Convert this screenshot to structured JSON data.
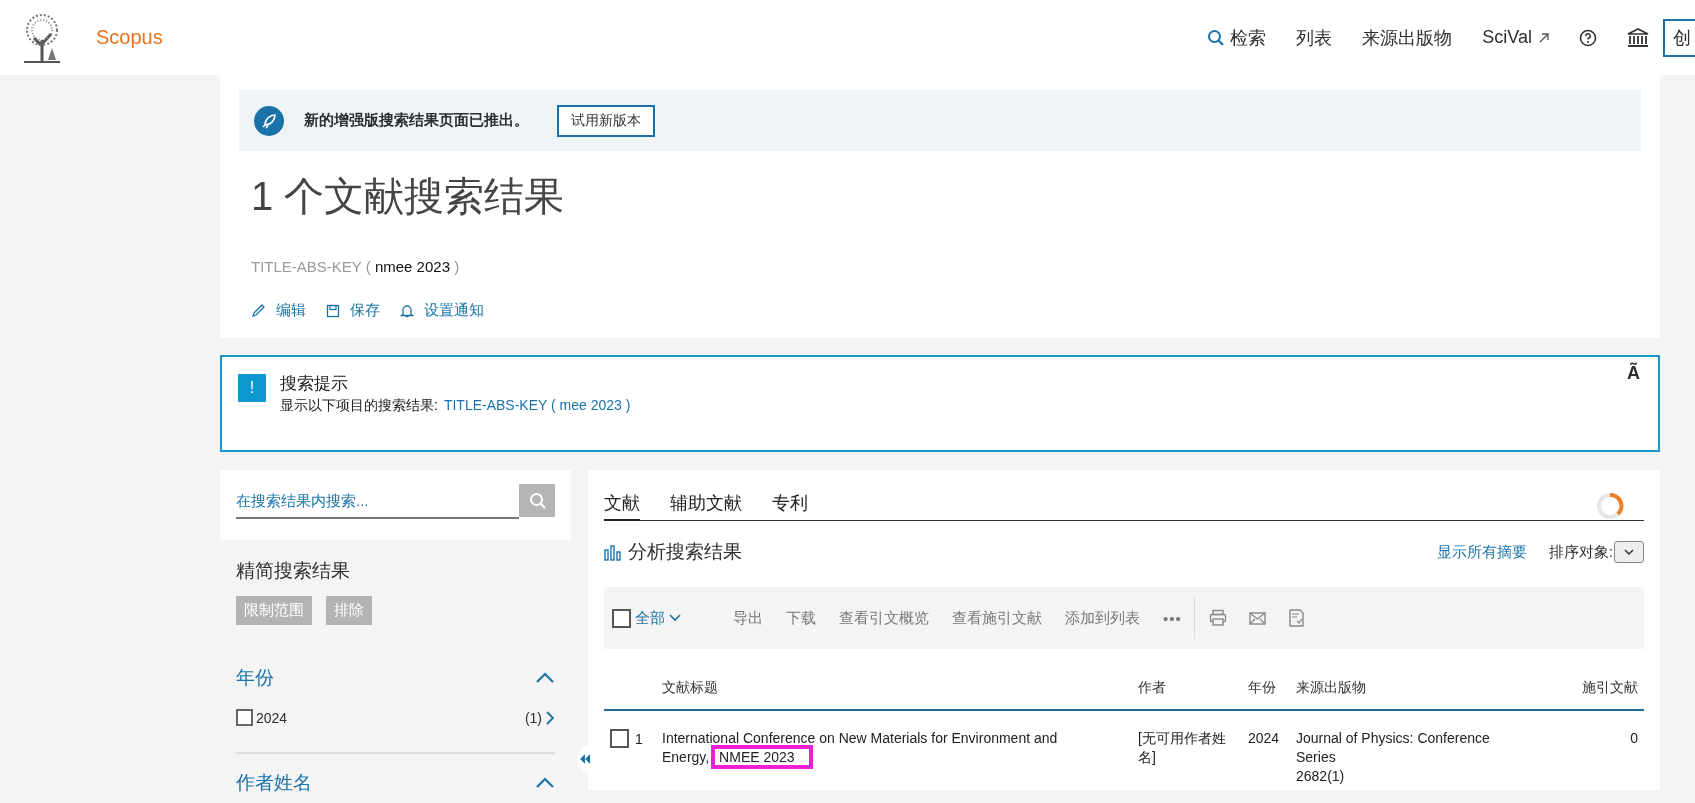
{
  "header": {
    "logo_text": "Scopus",
    "nav": [
      {
        "label": "检索",
        "kind": "search"
      },
      {
        "label": "列表",
        "kind": "plain"
      },
      {
        "label": "来源出版物",
        "kind": "plain"
      },
      {
        "label": "SciVal",
        "kind": "external"
      },
      {
        "kind": "help"
      },
      {
        "kind": "institution"
      }
    ],
    "account_button": "创"
  },
  "banner": {
    "message": "新的增强版搜索结果页面已推出。",
    "button": "试用新版本"
  },
  "summary": {
    "title": "1 个文献搜索结果",
    "query_field": "TITLE-ABS-KEY (",
    "query_terms": "nmee  2023",
    "query_close": ")",
    "actions": [
      {
        "label": "编辑",
        "kind": "edit"
      },
      {
        "label": "保存",
        "kind": "save"
      },
      {
        "label": "设置通知",
        "kind": "alert"
      }
    ]
  },
  "search_tip": {
    "badge": "!",
    "title": "搜索提示",
    "text": "显示以下项目的搜索结果:",
    "suggestion": "TITLE-ABS-KEY ( mee  2023 )",
    "close": "Ã"
  },
  "sidebar": {
    "search_placeholder": "在搜索结果内搜索...",
    "heading": "精简搜索结果",
    "buttons": [
      "限制范围",
      "排除"
    ],
    "facets": [
      {
        "title": "年份",
        "expanded": true,
        "items": [
          {
            "label": "2024",
            "count": "(1)",
            "checked": false
          }
        ]
      },
      {
        "title": "作者姓名",
        "expanded": true
      }
    ]
  },
  "results": {
    "tabs": [
      {
        "label": "文献",
        "selected": true
      },
      {
        "label": "辅助文献",
        "selected": false
      },
      {
        "label": "专利",
        "selected": false
      }
    ],
    "analyze": "分析搜索结果",
    "show_abstracts": "显示所有摘要",
    "sort_label": "排序对象:",
    "toolbar": {
      "select_all": "全部",
      "select_all_checked": false,
      "actions": [
        "导出",
        "下载",
        "查看引文概览",
        "查看施引文献",
        "添加到列表"
      ],
      "more": "•••"
    },
    "columns": [
      "文献标题",
      "作者",
      "年份",
      "来源出版物",
      "施引文献"
    ],
    "rows": [
      {
        "checked": false,
        "number": "1",
        "title_parts": [
          {
            "text": "International Conference on New Materials for Environment and Energy,",
            "highlighted": false
          },
          {
            "text": " NMEE 2023",
            "highlighted": true
          }
        ],
        "authors": "[无可用作者姓名]",
        "year": "2024",
        "source": "Journal of Physics: Conference Series",
        "issue": "2682(1)",
        "cited_by": "0"
      }
    ]
  }
}
